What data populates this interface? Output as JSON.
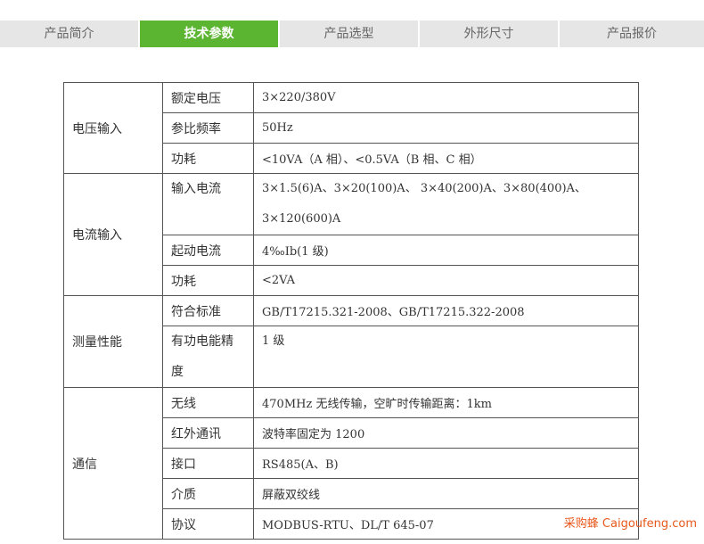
{
  "tabs": [
    {
      "label": "产品简介",
      "active": false
    },
    {
      "label": "技术参数",
      "active": true
    },
    {
      "label": "产品选型",
      "active": false
    },
    {
      "label": "外形尺寸",
      "active": false
    },
    {
      "label": "产品报价",
      "active": false
    }
  ],
  "spec": {
    "groups": [
      {
        "name": "电压输入",
        "rows": [
          {
            "param": "额定电压",
            "value": "3×220/380V"
          },
          {
            "param": "参比频率",
            "value": "50Hz"
          },
          {
            "param": "功耗",
            "value": "<10VA（A 相）、<0.5VA（B 相、C 相）"
          }
        ]
      },
      {
        "name": "电流输入",
        "rows": [
          {
            "param": "输入电流",
            "value": "3×1.5(6)A、3×20(100)A、 3×40(200)A、3×80(400)A、3×120(600)A"
          },
          {
            "param": "起动电流",
            "value": "4‰Ib(1 级)"
          },
          {
            "param": "功耗",
            "value": "<2VA"
          }
        ]
      },
      {
        "name": "测量性能",
        "rows": [
          {
            "param": "符合标准",
            "value": "GB/T17215.321-2008、GB/T17215.322-2008"
          },
          {
            "param": "有功电能精度",
            "value": "1 级"
          }
        ]
      },
      {
        "name": "通信",
        "rows": [
          {
            "param": "无线",
            "value": "470MHz 无线传输，空旷时传输距离：1km"
          },
          {
            "param": "红外通讯",
            "value": "波特率固定为 1200"
          },
          {
            "param": "接口",
            "value": "RS485(A、B)"
          },
          {
            "param": "介质",
            "value": "屏蔽双绞线"
          },
          {
            "param": "协议",
            "value": "MODBUS-RTU、DL/T 645-07"
          }
        ]
      }
    ]
  },
  "watermark": "采购蜂 Caigoufeng.com",
  "colors": {
    "tab_active": "#5cb531",
    "tab_inactive": "#e6e6e6",
    "border": "#555555"
  }
}
